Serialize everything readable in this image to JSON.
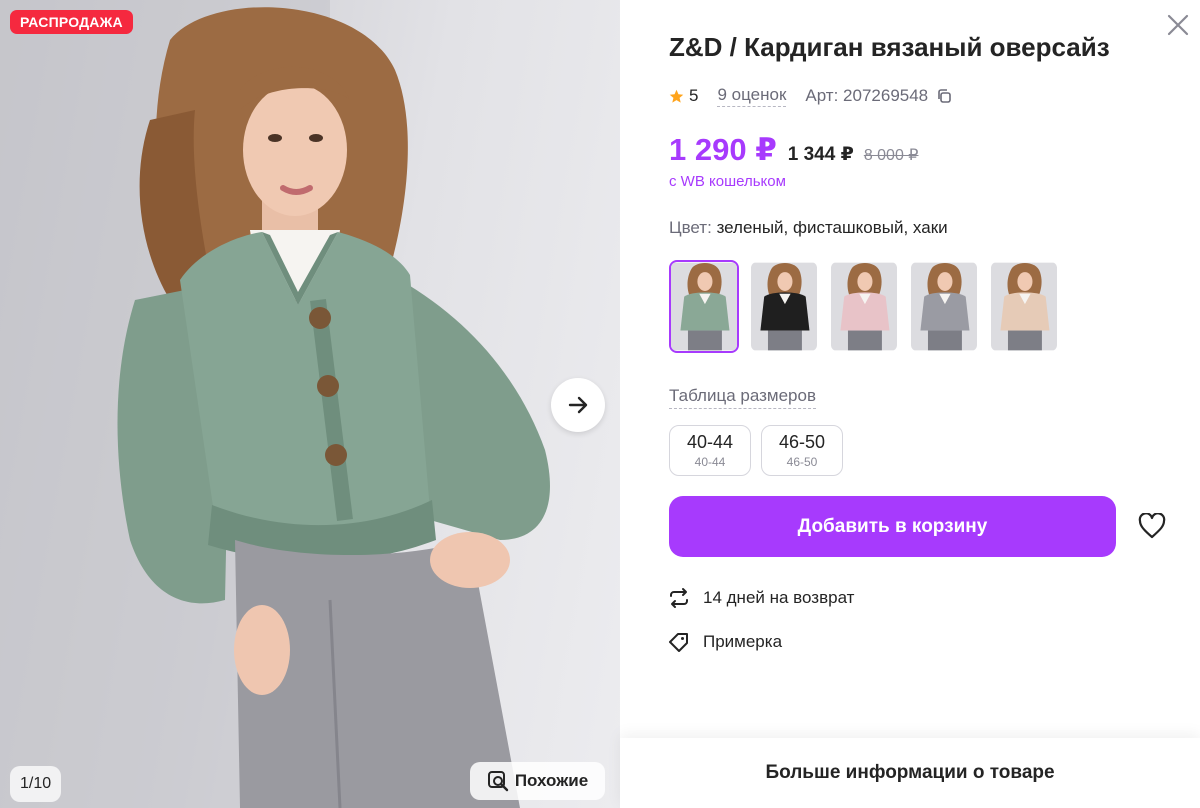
{
  "gallery": {
    "sale_badge": "РАСПРОДАЖА",
    "counter": "1/10",
    "similar_label": "Похожие",
    "next_icon": "arrow-right-icon"
  },
  "product": {
    "title": "Z&D / Кардиган вязаный оверсайз",
    "rating": "5",
    "reviews": "9 оценок",
    "article": "Арт: 207269548",
    "price_wallet": "1 290 ₽",
    "price": "1 344 ₽",
    "price_old": "8 000 ₽",
    "wallet_note": "с WB кошельком",
    "color_label": "Цвет:",
    "color_value": "зеленый, фисташковый, хаки",
    "colors": [
      {
        "name": "green",
        "hex": "#8aa896"
      },
      {
        "name": "black",
        "hex": "#1f1f1f"
      },
      {
        "name": "pink",
        "hex": "#e8c3c8"
      },
      {
        "name": "grey",
        "hex": "#9a9ba3"
      },
      {
        "name": "beige",
        "hex": "#e6cbb7"
      }
    ],
    "size_table_label": "Таблица размеров",
    "sizes": [
      {
        "main": "40-44",
        "sub": "40-44"
      },
      {
        "main": "46-50",
        "sub": "46-50"
      }
    ],
    "cart_button": "Добавить в корзину",
    "features": [
      {
        "icon": "return-arrows-icon",
        "label": "14 дней на возврат"
      },
      {
        "icon": "tag-icon",
        "label": "Примерка"
      }
    ],
    "more_info": "Больше информации о товаре"
  },
  "colors": {
    "accent": "#a73afd",
    "sale": "#f5293f",
    "text": "#242424",
    "muted": "#6b6b78",
    "star": "#ffa41c"
  }
}
